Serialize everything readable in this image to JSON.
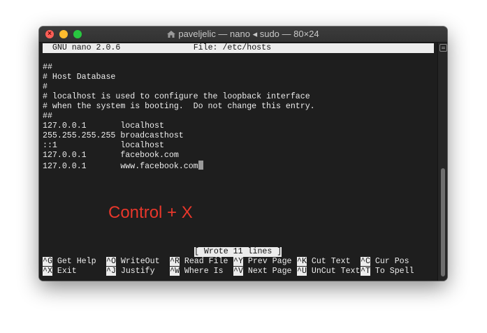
{
  "window": {
    "title": "paveljelic — nano ◂ sudo — 80×24",
    "title_icon": "house-icon"
  },
  "nano": {
    "header_version": "GNU nano 2.0.6",
    "header_file": "File: /etc/hosts",
    "lines": [
      "",
      "##",
      "# Host Database",
      "#",
      "# localhost is used to configure the loopback interface",
      "# when the system is booting.  Do not change this entry.",
      "##",
      "127.0.0.1       localhost",
      "255.255.255.255 broadcasthost",
      "::1             localhost",
      "127.0.0.1       facebook.com",
      "127.0.0.1       www.facebook.com"
    ],
    "status_message": "[ Wrote 11 lines ]",
    "shortcuts_row1": [
      {
        "key": "^G",
        "label": "Get Help"
      },
      {
        "key": "^O",
        "label": "WriteOut"
      },
      {
        "key": "^R",
        "label": "Read File"
      },
      {
        "key": "^Y",
        "label": "Prev Page"
      },
      {
        "key": "^K",
        "label": "Cut Text"
      },
      {
        "key": "^C",
        "label": "Cur Pos"
      }
    ],
    "shortcuts_row2": [
      {
        "key": "^X",
        "label": "Exit"
      },
      {
        "key": "^J",
        "label": "Justify"
      },
      {
        "key": "^W",
        "label": "Where Is"
      },
      {
        "key": "^V",
        "label": "Next Page"
      },
      {
        "key": "^U",
        "label": "UnCut Text"
      },
      {
        "key": "^T",
        "label": "To Spell"
      }
    ]
  },
  "annotation": {
    "text": "Control + X",
    "color": "#e8372b"
  },
  "colors": {
    "terminal_bg": "#1e1e1e",
    "terminal_fg": "#ededed",
    "close": "#ff5f57",
    "minimize": "#febc2e",
    "maximize": "#28c840"
  }
}
